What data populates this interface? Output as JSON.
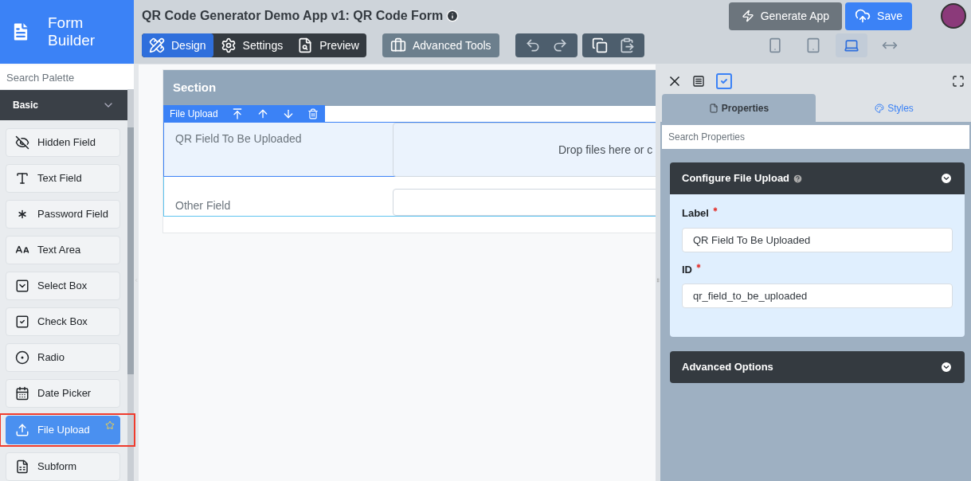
{
  "logo": {
    "title": "Form Builder"
  },
  "header": {
    "title": "QR Code Generator Demo App v1: QR Code Form"
  },
  "mode_tabs": [
    {
      "label": "Design",
      "selected": true
    },
    {
      "label": "Settings",
      "selected": false
    },
    {
      "label": "Preview",
      "selected": false
    }
  ],
  "advanced_tools": {
    "label": "Advanced Tools"
  },
  "actions": [
    {
      "label": "Generate App",
      "kind": "generate"
    },
    {
      "label": "Save",
      "kind": "save"
    }
  ],
  "devices": [
    {
      "kind": "phone",
      "selected": false
    },
    {
      "kind": "tablet",
      "selected": false
    },
    {
      "kind": "laptop",
      "selected": true
    },
    {
      "kind": "full",
      "selected": false
    }
  ],
  "palette": {
    "search_placeholder": "Search Palette",
    "group": "Basic",
    "items": [
      {
        "label": "Hidden Field",
        "kind": "hidden",
        "selected": false
      },
      {
        "label": "Text Field",
        "kind": "text",
        "selected": false
      },
      {
        "label": "Password Field",
        "kind": "password",
        "selected": false
      },
      {
        "label": "Text Area",
        "kind": "textarea",
        "selected": false
      },
      {
        "label": "Select Box",
        "kind": "select",
        "selected": false
      },
      {
        "label": "Check Box",
        "kind": "checkbox",
        "selected": false
      },
      {
        "label": "Radio",
        "kind": "radio",
        "selected": false
      },
      {
        "label": "Date Picker",
        "kind": "date",
        "selected": false
      },
      {
        "label": "File Upload",
        "kind": "file",
        "selected": true
      },
      {
        "label": "Subform",
        "kind": "subform",
        "selected": false
      }
    ]
  },
  "canvas": {
    "section_title": "Section",
    "toolbar_label": "File Upload",
    "fields": [
      {
        "label": "QR Field To Be Uploaded",
        "kind": "file",
        "selected": true,
        "drop_text": "Drop files here or c"
      },
      {
        "label": "Other Field",
        "kind": "text",
        "selected": false
      }
    ]
  },
  "properties": {
    "tabs": [
      {
        "label": "Properties",
        "selected": true
      },
      {
        "label": "Styles",
        "selected": false
      }
    ],
    "search_placeholder": "Search Properties",
    "panels": [
      {
        "title": "Configure File Upload",
        "expanded": true,
        "fields": [
          {
            "label": "Label",
            "required": true,
            "value": "QR Field To Be Uploaded"
          },
          {
            "label": "ID",
            "required": true,
            "value": "qr_field_to_be_uploaded"
          }
        ]
      },
      {
        "title": "Advanced Options",
        "expanded": false
      }
    ]
  }
}
